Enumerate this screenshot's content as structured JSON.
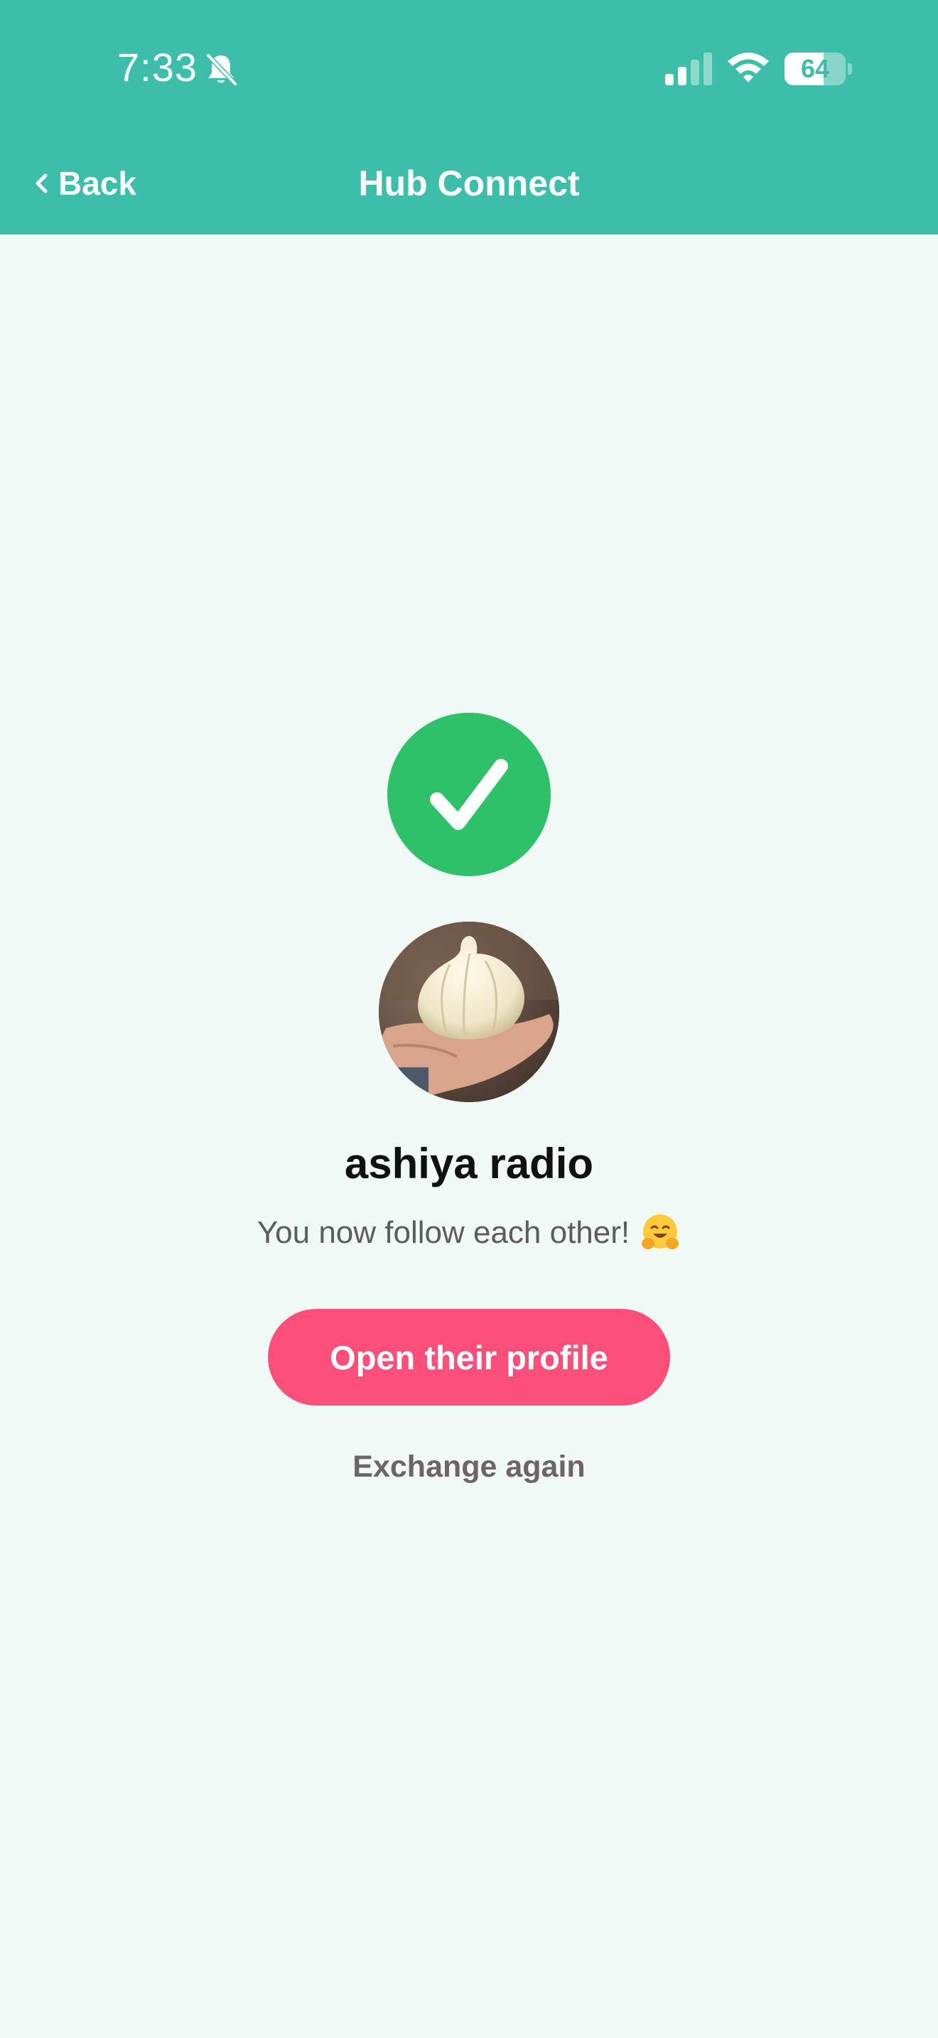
{
  "status_bar": {
    "time": "7:33",
    "battery_level": "64",
    "battery_fraction": 0.64,
    "icons": [
      "bell-slash-icon",
      "cellular-signal-icon",
      "wifi-icon",
      "battery-icon"
    ]
  },
  "nav": {
    "back_label": "Back",
    "title": "Hub Connect"
  },
  "result": {
    "success_icon": "checkmark-circle-icon",
    "avatar_description": "profile-photo",
    "user_name": "ashiya radio",
    "message": "You now follow each other!",
    "message_emoji": "hugging-face-emoji-icon"
  },
  "actions": {
    "open_profile_label": "Open their profile",
    "exchange_again_label": "Exchange again"
  },
  "colors": {
    "header_bg": "#3CBEAA",
    "page_bg": "#F0F9F5",
    "success_green": "#2FC16A",
    "primary_button": "#FB4F7B",
    "secondary_text": "#6E6467"
  }
}
